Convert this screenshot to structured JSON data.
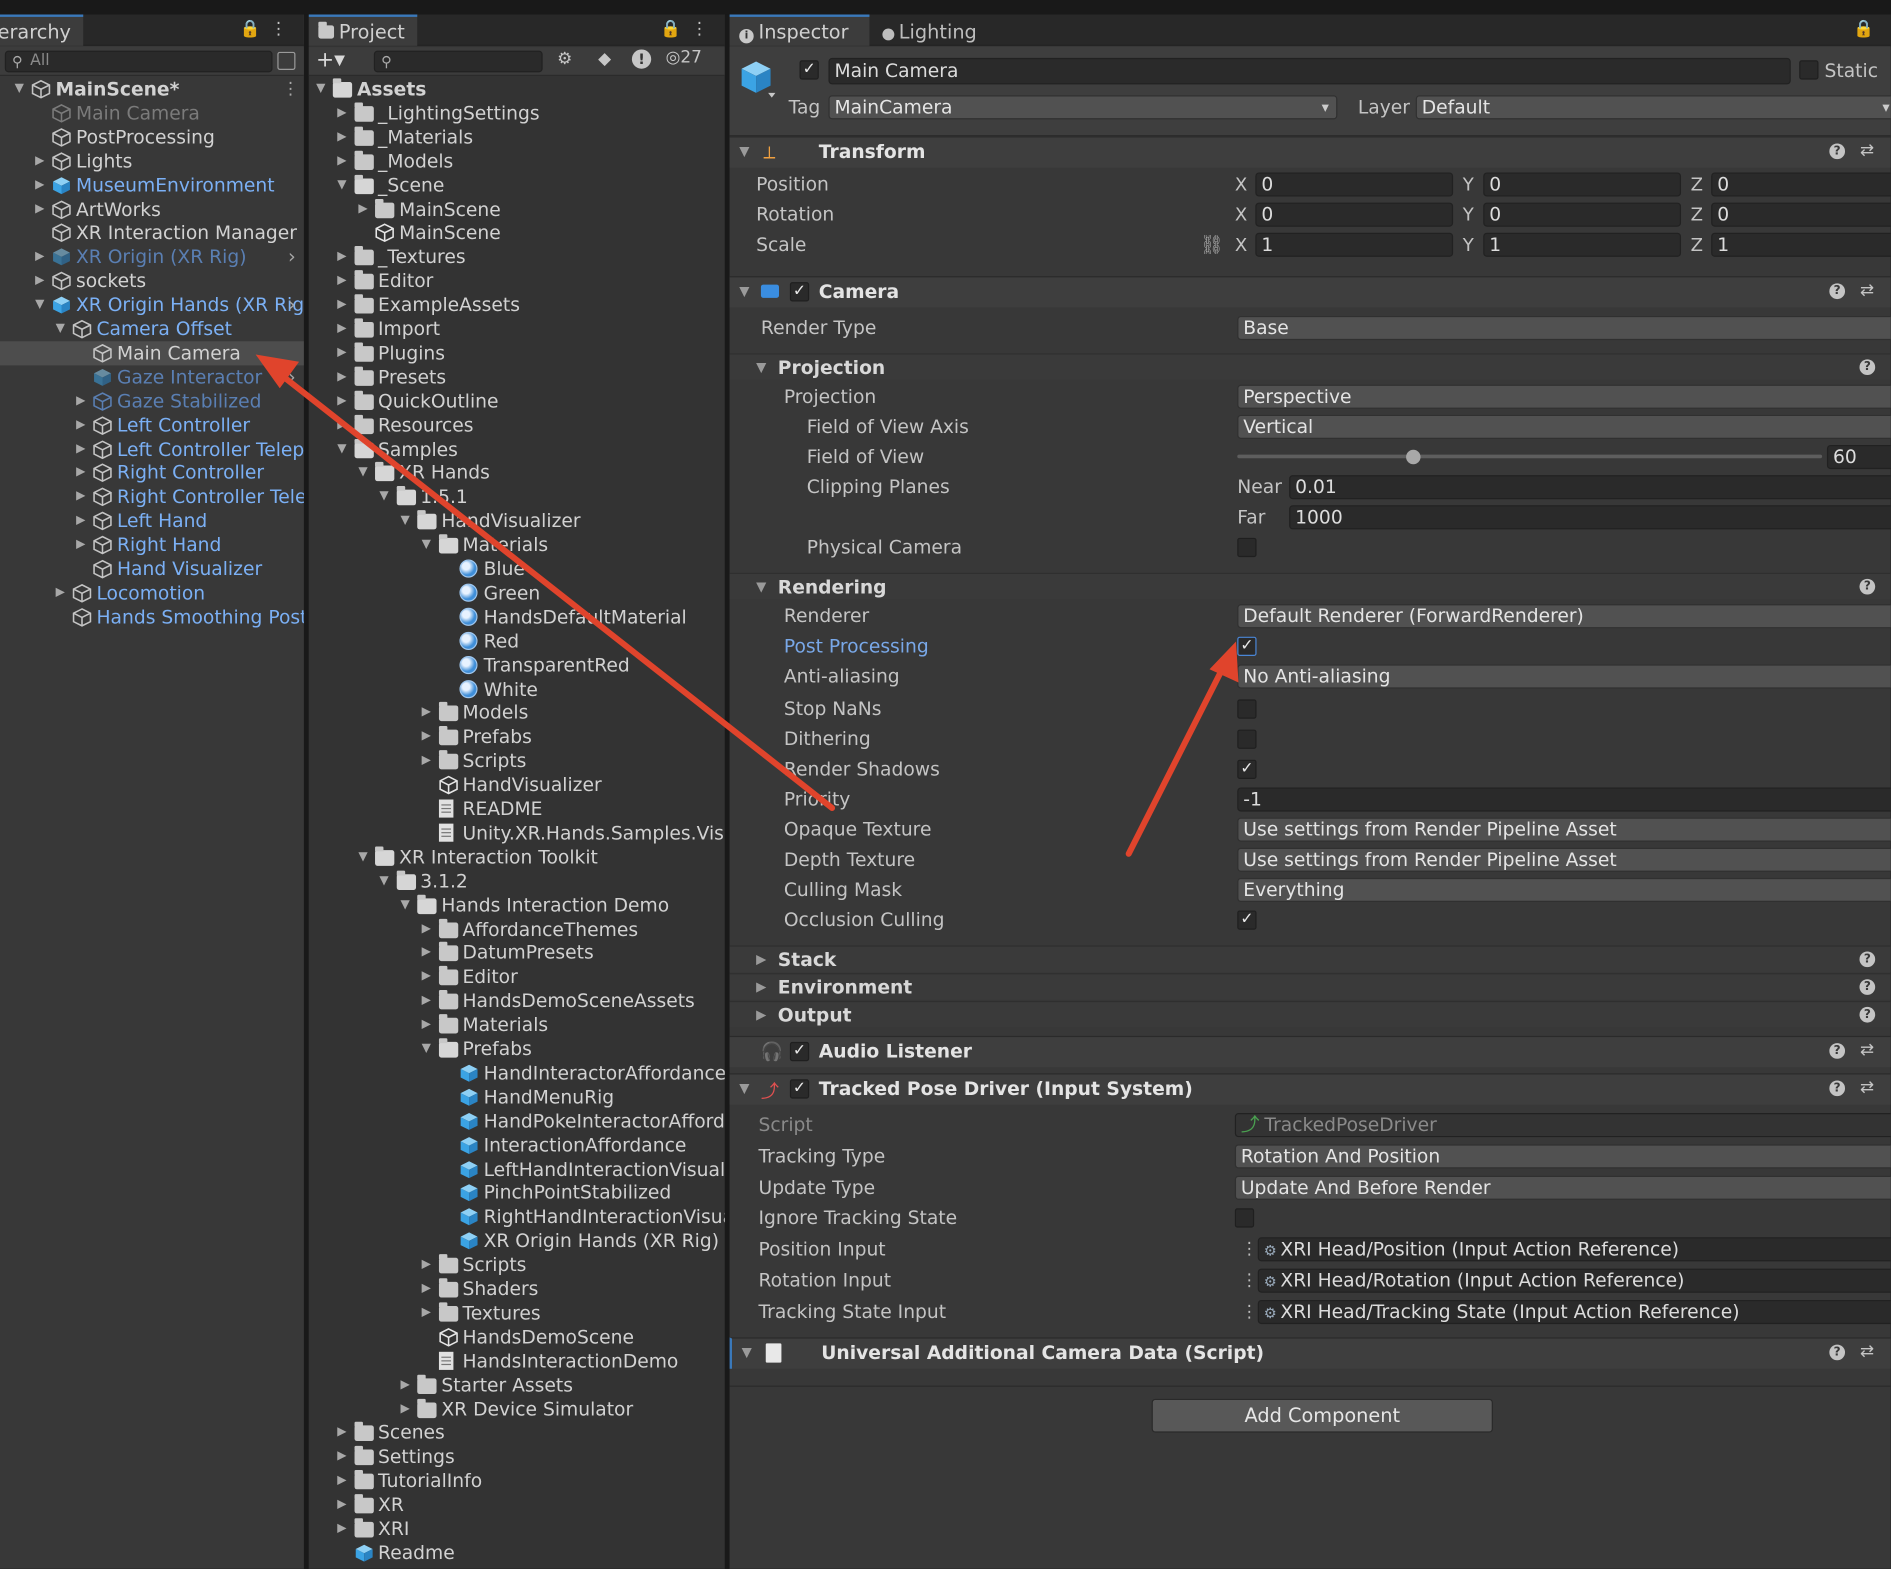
{
  "hierarchy": {
    "tab": "erarchy",
    "search_placeholder": "All",
    "items": [
      {
        "label": "MainScene*",
        "kind": "scene",
        "depth": 0,
        "arrow": "open"
      },
      {
        "label": "Main Camera",
        "kind": "go",
        "depth": 1,
        "arrow": "",
        "state": "disabled"
      },
      {
        "label": "PostProcessing",
        "kind": "go",
        "depth": 1,
        "arrow": ""
      },
      {
        "label": "Lights",
        "kind": "go",
        "depth": 1,
        "arrow": "closed"
      },
      {
        "label": "MuseumEnvironment",
        "kind": "prefab",
        "depth": 1,
        "arrow": "closed"
      },
      {
        "label": "ArtWorks",
        "kind": "go",
        "depth": 1,
        "arrow": "closed"
      },
      {
        "label": "XR Interaction Manager",
        "kind": "go",
        "depth": 1,
        "arrow": ""
      },
      {
        "label": "XR Origin (XR Rig)",
        "kind": "prefabdis",
        "depth": 1,
        "arrow": "closed",
        "more": true
      },
      {
        "label": "sockets",
        "kind": "go",
        "depth": 1,
        "arrow": "closed"
      },
      {
        "label": "XR Origin Hands (XR Rig)",
        "kind": "prefab",
        "depth": 1,
        "arrow": "open",
        "more": true
      },
      {
        "label": "Camera Offset",
        "kind": "goblue",
        "depth": 2,
        "arrow": "open"
      },
      {
        "label": "Main Camera",
        "kind": "go",
        "depth": 3,
        "arrow": "",
        "selected": true
      },
      {
        "label": "Gaze Interactor",
        "kind": "prefabdis",
        "depth": 3,
        "arrow": "",
        "more": true
      },
      {
        "label": "Gaze Stabilized",
        "kind": "prefabdis2",
        "depth": 3,
        "arrow": "closed"
      },
      {
        "label": "Left Controller",
        "kind": "goblue",
        "depth": 3,
        "arrow": "closed"
      },
      {
        "label": "Left Controller Teleport",
        "kind": "goblue",
        "depth": 3,
        "arrow": "closed"
      },
      {
        "label": "Right Controller",
        "kind": "goblue",
        "depth": 3,
        "arrow": "closed"
      },
      {
        "label": "Right Controller Telepor",
        "kind": "goblue",
        "depth": 3,
        "arrow": "closed"
      },
      {
        "label": "Left Hand",
        "kind": "goblue",
        "depth": 3,
        "arrow": "closed"
      },
      {
        "label": "Right Hand",
        "kind": "goblue",
        "depth": 3,
        "arrow": "closed"
      },
      {
        "label": "Hand Visualizer",
        "kind": "goblue",
        "depth": 3,
        "arrow": ""
      },
      {
        "label": "Locomotion",
        "kind": "goblue",
        "depth": 2,
        "arrow": "closed"
      },
      {
        "label": "Hands Smoothing Post Pro",
        "kind": "goblue",
        "depth": 2,
        "arrow": ""
      }
    ]
  },
  "project": {
    "tab": "Project",
    "count": "27",
    "items": [
      {
        "label": "Assets",
        "icon": "folder",
        "depth": 0,
        "arrow": "open",
        "bold": true
      },
      {
        "label": "_LightingSettings",
        "icon": "folder",
        "depth": 1,
        "arrow": "closed"
      },
      {
        "label": "_Materials",
        "icon": "folder",
        "depth": 1,
        "arrow": "closed"
      },
      {
        "label": "_Models",
        "icon": "folder",
        "depth": 1,
        "arrow": "closed"
      },
      {
        "label": "_Scene",
        "icon": "folder",
        "depth": 1,
        "arrow": "open"
      },
      {
        "label": "MainScene",
        "icon": "folder",
        "depth": 2,
        "arrow": "closed"
      },
      {
        "label": "MainScene",
        "icon": "scene",
        "depth": 2,
        "arrow": ""
      },
      {
        "label": "_Textures",
        "icon": "folder",
        "depth": 1,
        "arrow": "closed"
      },
      {
        "label": "Editor",
        "icon": "folder",
        "depth": 1,
        "arrow": "closed"
      },
      {
        "label": "ExampleAssets",
        "icon": "folder",
        "depth": 1,
        "arrow": "closed"
      },
      {
        "label": "Import",
        "icon": "folder",
        "depth": 1,
        "arrow": "closed"
      },
      {
        "label": "Plugins",
        "icon": "folder",
        "depth": 1,
        "arrow": "closed"
      },
      {
        "label": "Presets",
        "icon": "folder",
        "depth": 1,
        "arrow": "closed"
      },
      {
        "label": "QuickOutline",
        "icon": "folder",
        "depth": 1,
        "arrow": "closed"
      },
      {
        "label": "Resources",
        "icon": "folder",
        "depth": 1,
        "arrow": "closed"
      },
      {
        "label": "Samples",
        "icon": "folder",
        "depth": 1,
        "arrow": "open"
      },
      {
        "label": "XR Hands",
        "icon": "folder",
        "depth": 2,
        "arrow": "open"
      },
      {
        "label": "1.5.1",
        "icon": "folder",
        "depth": 3,
        "arrow": "open"
      },
      {
        "label": "HandVisualizer",
        "icon": "folder",
        "depth": 4,
        "arrow": "open"
      },
      {
        "label": "Materials",
        "icon": "folder",
        "depth": 5,
        "arrow": "open"
      },
      {
        "label": "Blue",
        "icon": "material",
        "depth": 6,
        "arrow": ""
      },
      {
        "label": "Green",
        "icon": "material",
        "depth": 6,
        "arrow": ""
      },
      {
        "label": "HandsDefaultMaterial",
        "icon": "material",
        "depth": 6,
        "arrow": ""
      },
      {
        "label": "Red",
        "icon": "material",
        "depth": 6,
        "arrow": ""
      },
      {
        "label": "TransparentRed",
        "icon": "material",
        "depth": 6,
        "arrow": ""
      },
      {
        "label": "White",
        "icon": "material",
        "depth": 6,
        "arrow": ""
      },
      {
        "label": "Models",
        "icon": "folder",
        "depth": 5,
        "arrow": "closed"
      },
      {
        "label": "Prefabs",
        "icon": "folder",
        "depth": 5,
        "arrow": "closed"
      },
      {
        "label": "Scripts",
        "icon": "folder",
        "depth": 5,
        "arrow": "closed"
      },
      {
        "label": "HandVisualizer",
        "icon": "scene",
        "depth": 5,
        "arrow": ""
      },
      {
        "label": "README",
        "icon": "doc",
        "depth": 5,
        "arrow": ""
      },
      {
        "label": "Unity.XR.Hands.Samples.Visu",
        "icon": "doc",
        "depth": 5,
        "arrow": ""
      },
      {
        "label": "XR Interaction Toolkit",
        "icon": "folder",
        "depth": 2,
        "arrow": "open"
      },
      {
        "label": "3.1.2",
        "icon": "folder",
        "depth": 3,
        "arrow": "open"
      },
      {
        "label": "Hands Interaction Demo",
        "icon": "folder",
        "depth": 4,
        "arrow": "open"
      },
      {
        "label": "AffordanceThemes",
        "icon": "folder",
        "depth": 5,
        "arrow": "closed"
      },
      {
        "label": "DatumPresets",
        "icon": "folder",
        "depth": 5,
        "arrow": "closed"
      },
      {
        "label": "Editor",
        "icon": "folder",
        "depth": 5,
        "arrow": "closed"
      },
      {
        "label": "HandsDemoSceneAssets",
        "icon": "folder",
        "depth": 5,
        "arrow": "closed"
      },
      {
        "label": "Materials",
        "icon": "folder",
        "depth": 5,
        "arrow": "closed"
      },
      {
        "label": "Prefabs",
        "icon": "folder",
        "depth": 5,
        "arrow": "open"
      },
      {
        "label": "HandInteractorAffordances",
        "icon": "prefab",
        "depth": 6,
        "arrow": ""
      },
      {
        "label": "HandMenuRig",
        "icon": "prefab",
        "depth": 6,
        "arrow": ""
      },
      {
        "label": "HandPokeInteractorAfforda",
        "icon": "prefab",
        "depth": 6,
        "arrow": ""
      },
      {
        "label": "InteractionAffordance",
        "icon": "prefab",
        "depth": 6,
        "arrow": ""
      },
      {
        "label": "LeftHandInteractionVisual",
        "icon": "prefab",
        "depth": 6,
        "arrow": ""
      },
      {
        "label": "PinchPointStabilized",
        "icon": "prefab",
        "depth": 6,
        "arrow": ""
      },
      {
        "label": "RightHandInteractionVisual",
        "icon": "prefab",
        "depth": 6,
        "arrow": ""
      },
      {
        "label": "XR Origin Hands (XR Rig)",
        "icon": "prefab",
        "depth": 6,
        "arrow": ""
      },
      {
        "label": "Scripts",
        "icon": "folder",
        "depth": 5,
        "arrow": "closed"
      },
      {
        "label": "Shaders",
        "icon": "folder",
        "depth": 5,
        "arrow": "closed"
      },
      {
        "label": "Textures",
        "icon": "folder",
        "depth": 5,
        "arrow": "closed"
      },
      {
        "label": "HandsDemoScene",
        "icon": "scene",
        "depth": 5,
        "arrow": ""
      },
      {
        "label": "HandsInteractionDemo",
        "icon": "doc",
        "depth": 5,
        "arrow": ""
      },
      {
        "label": "Starter Assets",
        "icon": "folder",
        "depth": 4,
        "arrow": "closed"
      },
      {
        "label": "XR Device Simulator",
        "icon": "folder",
        "depth": 4,
        "arrow": "closed"
      },
      {
        "label": "Scenes",
        "icon": "folder",
        "depth": 1,
        "arrow": "closed"
      },
      {
        "label": "Settings",
        "icon": "folder",
        "depth": 1,
        "arrow": "closed"
      },
      {
        "label": "TutorialInfo",
        "icon": "folder",
        "depth": 1,
        "arrow": "closed"
      },
      {
        "label": "XR",
        "icon": "folder",
        "depth": 1,
        "arrow": "closed"
      },
      {
        "label": "XRI",
        "icon": "folder",
        "depth": 1,
        "arrow": "closed"
      },
      {
        "label": "Readme",
        "icon": "prefab",
        "depth": 1,
        "arrow": ""
      }
    ]
  },
  "inspector": {
    "tabs": {
      "inspector": "Inspector",
      "lighting": "Lighting"
    },
    "object_name": "Main Camera",
    "static_label": "Static",
    "tag_label": "Tag",
    "tag_value": "MainCamera",
    "layer_label": "Layer",
    "layer_value": "Default",
    "transform": {
      "title": "Transform",
      "position_label": "Position",
      "rotation_label": "Rotation",
      "scale_label": "Scale",
      "position": [
        "0",
        "0",
        "0"
      ],
      "rotation": [
        "0",
        "0",
        "0"
      ],
      "scale": [
        "1",
        "1",
        "1"
      ],
      "axes": [
        "X",
        "Y",
        "Z"
      ]
    },
    "camera": {
      "title": "Camera",
      "render_type_label": "Render Type",
      "render_type": "Base",
      "projection_header": "Projection",
      "projection_label": "Projection",
      "projection": "Perspective",
      "fov_axis_label": "Field of View Axis",
      "fov_axis": "Vertical",
      "fov_label": "Field of View",
      "fov": "60",
      "fov_slider_fraction": 0.3,
      "clipping_label": "Clipping Planes",
      "near_label": "Near",
      "near": "0.01",
      "far_label": "Far",
      "far": "1000",
      "physical_label": "Physical Camera",
      "rendering_header": "Rendering",
      "renderer_label": "Renderer",
      "renderer": "Default Renderer (ForwardRenderer)",
      "post_label": "Post Processing",
      "aa_label": "Anti-aliasing",
      "aa": "No Anti-aliasing",
      "stopnans_label": "Stop NaNs",
      "dither_label": "Dithering",
      "shadows_label": "Render Shadows",
      "priority_label": "Priority",
      "priority": "-1",
      "opaque_label": "Opaque Texture",
      "opaque": "Use settings from Render Pipeline Asset",
      "depth_label": "Depth Texture",
      "depth": "Use settings from Render Pipeline Asset",
      "culling_label": "Culling Mask",
      "culling": "Everything",
      "occlusion_label": "Occlusion Culling",
      "stack_header": "Stack",
      "env_header": "Environment",
      "output_header": "Output"
    },
    "audio": {
      "title": "Audio Listener"
    },
    "tracked": {
      "title": "Tracked Pose Driver (Input System)",
      "script_label": "Script",
      "script": "TrackedPoseDriver",
      "tracking_type_label": "Tracking Type",
      "tracking_type": "Rotation And Position",
      "update_type_label": "Update Type",
      "update_type": "Update And Before Render",
      "ignore_label": "Ignore Tracking State",
      "pos_input_label": "Position Input",
      "pos_input": "XRI Head/Position (Input Action Reference)",
      "rot_input_label": "Rotation Input",
      "rot_input": "XRI Head/Rotation (Input Action Reference)",
      "state_input_label": "Tracking State Input",
      "state_input": "XRI Head/Tracking State (Input Action Reference)"
    },
    "uacd": {
      "title": "Universal Additional Camera Data (Script)"
    },
    "add_component": "Add Component"
  },
  "colors": {
    "accent": "#3a79bb",
    "prefab_text": "#7bb0f5",
    "annotation_arrow": "#e0442c"
  }
}
